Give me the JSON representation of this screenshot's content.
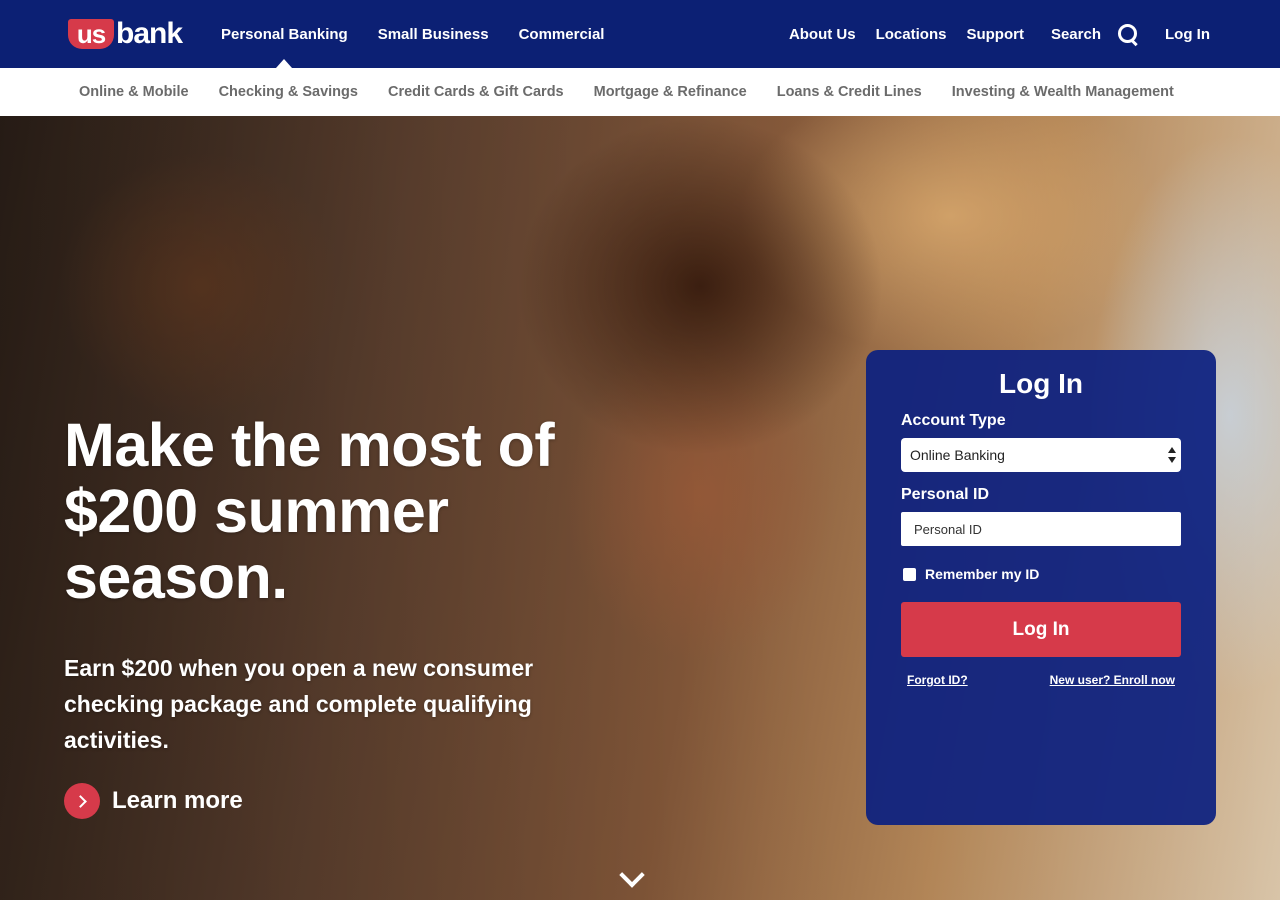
{
  "brand": {
    "logo_us": "us",
    "logo_bank": "bank",
    "colors": {
      "navy": "#0c2074",
      "red": "#d63a4a"
    }
  },
  "topnav": {
    "primary": [
      "Personal Banking",
      "Small Business",
      "Commercial"
    ],
    "active": "Personal Banking",
    "about": "About Us",
    "locations": "Locations",
    "support": "Support",
    "search": "Search",
    "login": "Log In"
  },
  "subnav": [
    "Online & Mobile",
    "Checking & Savings",
    "Credit Cards & Gift Cards",
    "Mortgage & Refinance",
    "Loans & Credit Lines",
    "Investing & Wealth Management"
  ],
  "hero": {
    "headline": "Make the most of $200 summer season.",
    "subhead": "Earn $200 when you open a new consumer checking package and complete qualifying activities.",
    "learn_more": "Learn more"
  },
  "login": {
    "title": "Log In",
    "account_type_label": "Account Type",
    "account_type_value": "Online Banking",
    "personal_id_label": "Personal ID",
    "personal_id_placeholder": "Personal ID",
    "remember_label": "Remember my ID",
    "button": "Log In",
    "forgot": "Forgot ID?",
    "enroll": "New user? Enroll now"
  }
}
